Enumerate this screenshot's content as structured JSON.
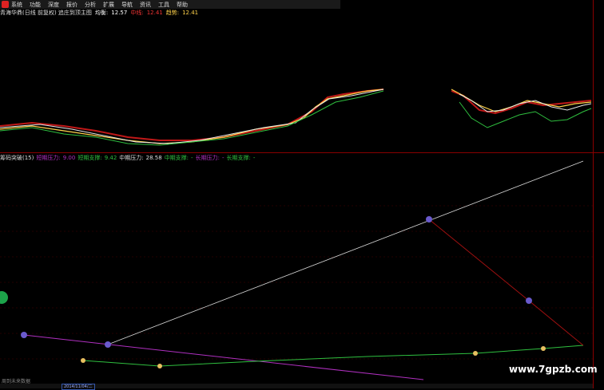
{
  "menu": {
    "items": [
      "系统",
      "功能",
      "深度",
      "报价",
      "分析",
      "扩展",
      "导航",
      "资讯",
      "工具",
      "帮助"
    ]
  },
  "title": {
    "name": "青海华鼎(日线 前复权) 追庄到顶主图",
    "avg_label": "均衡:",
    "avg_value": "12.57",
    "mid_label": "中线:",
    "mid_value": "12.41",
    "trend_label": "趋势:",
    "trend_value": "12.41"
  },
  "indicator": {
    "name": "筹码突破(15)",
    "short_pressure_label": "短期压力:",
    "short_pressure_value": "9.00",
    "short_support_label": "短期支撑:",
    "short_support_value": "9.42",
    "mid_pressure_label": "中期压力:",
    "mid_pressure_value": "28.58",
    "mid_support_label": "中期支撑:",
    "mid_support_value": "-",
    "long_pressure_label": "长期压力:",
    "long_pressure_value": "-",
    "long_support_label": "长期支撑:",
    "long_support_value": "-"
  },
  "status": {
    "left": "周到未来数据",
    "date": "2014/11/04/二"
  },
  "watermark": "www.7gpzb.com",
  "colors": {
    "accent_red": "#aa2222",
    "line_white": "#d8d8d8",
    "line_purple": "#b030c0",
    "line_green": "#2fbf3f",
    "line_darkred": "#a01010"
  }
}
